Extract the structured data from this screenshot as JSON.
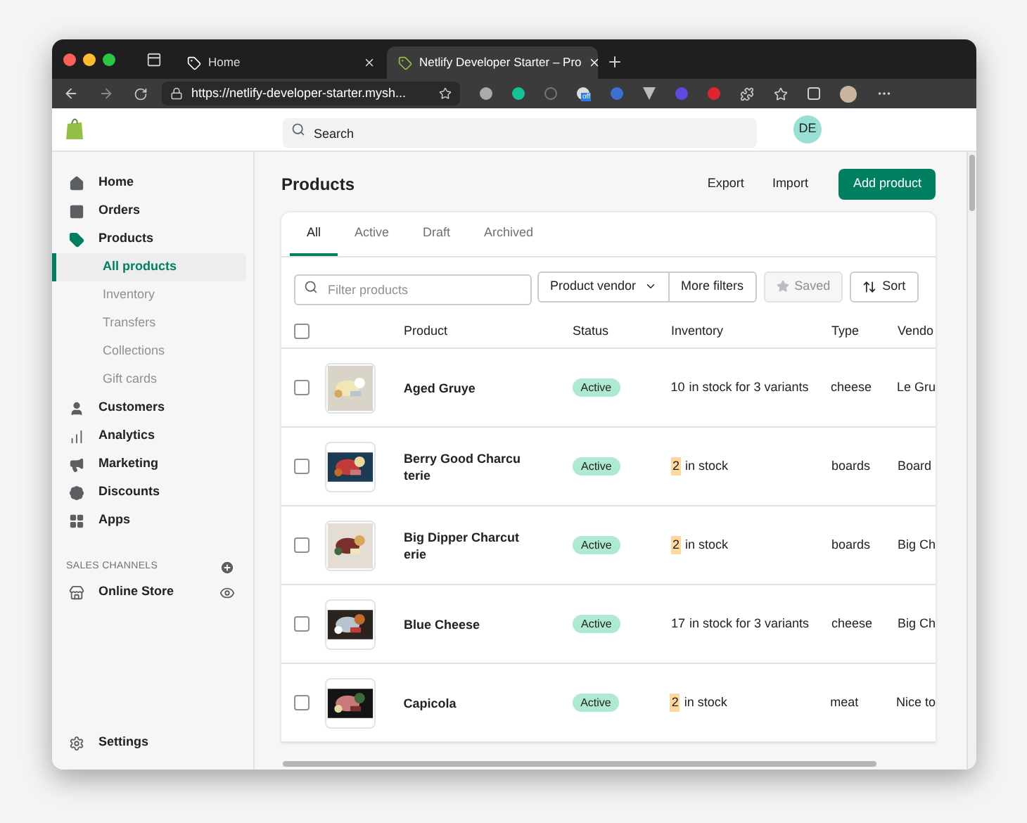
{
  "browser": {
    "tabs": [
      {
        "title": "Home",
        "selected": false
      },
      {
        "title": "Netlify Developer Starter – Pro",
        "selected": true
      }
    ],
    "url": "https://netlify-developer-starter.mysh...",
    "extension_badge": "off"
  },
  "header": {
    "search": {
      "placeholder": "Search"
    },
    "avatar": "DE"
  },
  "sidebar": {
    "items": [
      {
        "label": "Home"
      },
      {
        "label": "Orders"
      },
      {
        "label": "Products",
        "children": [
          {
            "label": "All products",
            "selected": true
          },
          {
            "label": "Inventory",
            "selected": false
          },
          {
            "label": "Transfers",
            "selected": false
          },
          {
            "label": "Collections",
            "selected": false
          },
          {
            "label": "Gift cards",
            "selected": false
          }
        ]
      },
      {
        "label": "Customers"
      },
      {
        "label": "Analytics"
      },
      {
        "label": "Marketing"
      },
      {
        "label": "Discounts"
      },
      {
        "label": "Apps"
      }
    ],
    "sales_channels": {
      "title": "SALES CHANNELS",
      "items": [
        {
          "label": "Online Store"
        }
      ]
    },
    "settings": "Settings"
  },
  "page": {
    "title": "Products",
    "actions": [
      "Export",
      "Import"
    ],
    "primary_action": "Add product"
  },
  "tabs": [
    {
      "label": "All",
      "selected": true
    },
    {
      "label": "Active",
      "selected": false
    },
    {
      "label": "Draft",
      "selected": false
    },
    {
      "label": "Archived",
      "selected": false
    }
  ],
  "filters": {
    "placeholder": "Filter products",
    "buttons": [
      {
        "label": "Product vendor",
        "kind": "dropdown",
        "disabled": false
      },
      {
        "label": "More filters",
        "kind": "plain",
        "disabled": false
      },
      {
        "label": "Saved",
        "kind": "star",
        "disabled": true
      },
      {
        "label": "Sort",
        "kind": "sort",
        "disabled": false
      }
    ]
  },
  "table": {
    "header_checked": false,
    "columns": [
      "Product",
      "Status",
      "Inventory",
      "Type",
      "Vendo"
    ],
    "rows": [
      {
        "checked": false,
        "product": "Aged Gruye",
        "status": "Active",
        "inventory": {
          "count": "10",
          "rest": "in stock for 3 variants",
          "low": false
        },
        "type": "cheese",
        "vendor": "Le Gru"
      },
      {
        "checked": false,
        "product": "Berry Good Charcuterie",
        "status": "Active",
        "inventory": {
          "count": "2",
          "rest": "in stock",
          "low": true
        },
        "type": "boards",
        "vendor": "Board"
      },
      {
        "checked": false,
        "product": "Big Dipper Charcuterie",
        "status": "Active",
        "inventory": {
          "count": "2",
          "rest": "in stock",
          "low": true
        },
        "type": "boards",
        "vendor": "Big Ch"
      },
      {
        "checked": false,
        "product": "Blue Cheese",
        "status": "Active",
        "inventory": {
          "count": "17",
          "rest": "in stock for 3 variants",
          "low": false
        },
        "type": "cheese",
        "vendor": "Big Ch"
      },
      {
        "checked": false,
        "product": "Capicola",
        "status": "Active",
        "inventory": {
          "count": "2",
          "rest": "in stock",
          "low": true
        },
        "type": "meat",
        "vendor": "Nice to"
      }
    ]
  }
}
